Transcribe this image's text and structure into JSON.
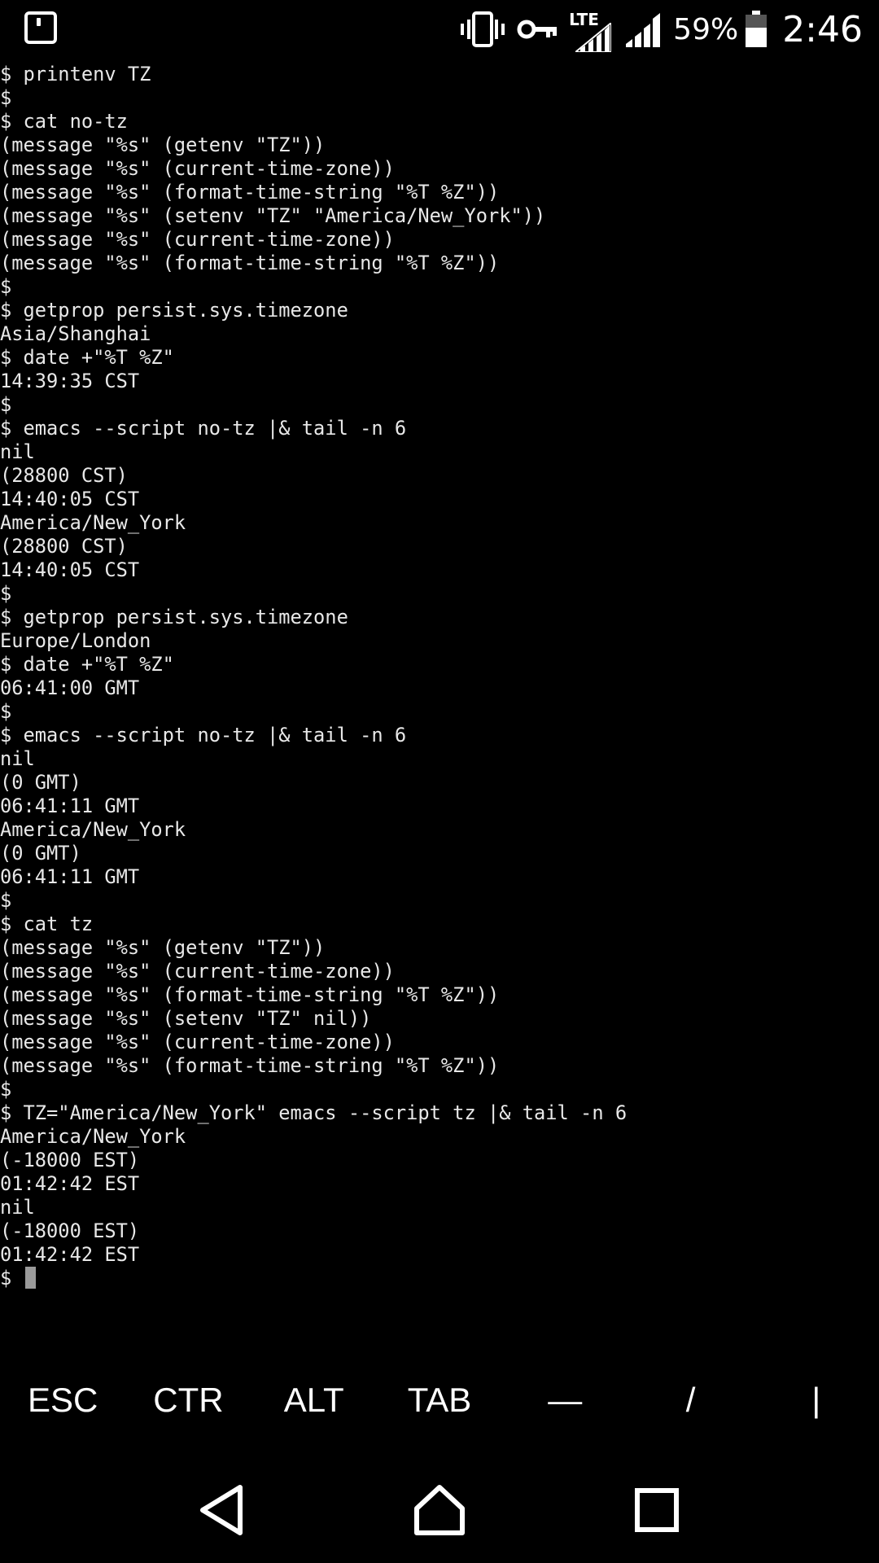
{
  "status_bar": {
    "network": "LTE",
    "battery": "59%",
    "time": "2:46",
    "icons": [
      "notification-icon",
      "vibrate-icon",
      "vpn-key-icon",
      "lte-signal-icon",
      "signal-icon",
      "battery-icon"
    ]
  },
  "terminal": {
    "lines": [
      "$ printenv TZ",
      "$",
      "$ cat no-tz",
      "(message \"%s\" (getenv \"TZ\"))",
      "(message \"%s\" (current-time-zone))",
      "(message \"%s\" (format-time-string \"%T %Z\"))",
      "(message \"%s\" (setenv \"TZ\" \"America/New_York\"))",
      "(message \"%s\" (current-time-zone))",
      "(message \"%s\" (format-time-string \"%T %Z\"))",
      "$",
      "$ getprop persist.sys.timezone",
      "Asia/Shanghai",
      "$ date +\"%T %Z\"",
      "14:39:35 CST",
      "$",
      "$ emacs --script no-tz |& tail -n 6",
      "nil",
      "(28800 CST)",
      "14:40:05 CST",
      "America/New_York",
      "(28800 CST)",
      "14:40:05 CST",
      "$",
      "$ getprop persist.sys.timezone",
      "Europe/London",
      "$ date +\"%T %Z\"",
      "06:41:00 GMT",
      "$",
      "$ emacs --script no-tz |& tail -n 6",
      "nil",
      "(0 GMT)",
      "06:41:11 GMT",
      "America/New_York",
      "(0 GMT)",
      "06:41:11 GMT",
      "$",
      "$ cat tz",
      "(message \"%s\" (getenv \"TZ\"))",
      "(message \"%s\" (current-time-zone))",
      "(message \"%s\" (format-time-string \"%T %Z\"))",
      "(message \"%s\" (setenv \"TZ\" nil))",
      "(message \"%s\" (current-time-zone))",
      "(message \"%s\" (format-time-string \"%T %Z\"))",
      "$",
      "$ TZ=\"America/New_York\" emacs --script tz |& tail -n 6",
      "America/New_York",
      "(-18000 EST)",
      "01:42:42 EST",
      "nil",
      "(-18000 EST)",
      "01:42:42 EST"
    ],
    "prompt": "$ "
  },
  "extra_keys": {
    "esc": "ESC",
    "ctrl": "CTR",
    "alt": "ALT",
    "tab": "TAB",
    "dash": "—",
    "slash": "/",
    "pipe": "|"
  },
  "nav_bar": {
    "icons": [
      "back-icon",
      "home-icon",
      "recents-icon"
    ]
  }
}
